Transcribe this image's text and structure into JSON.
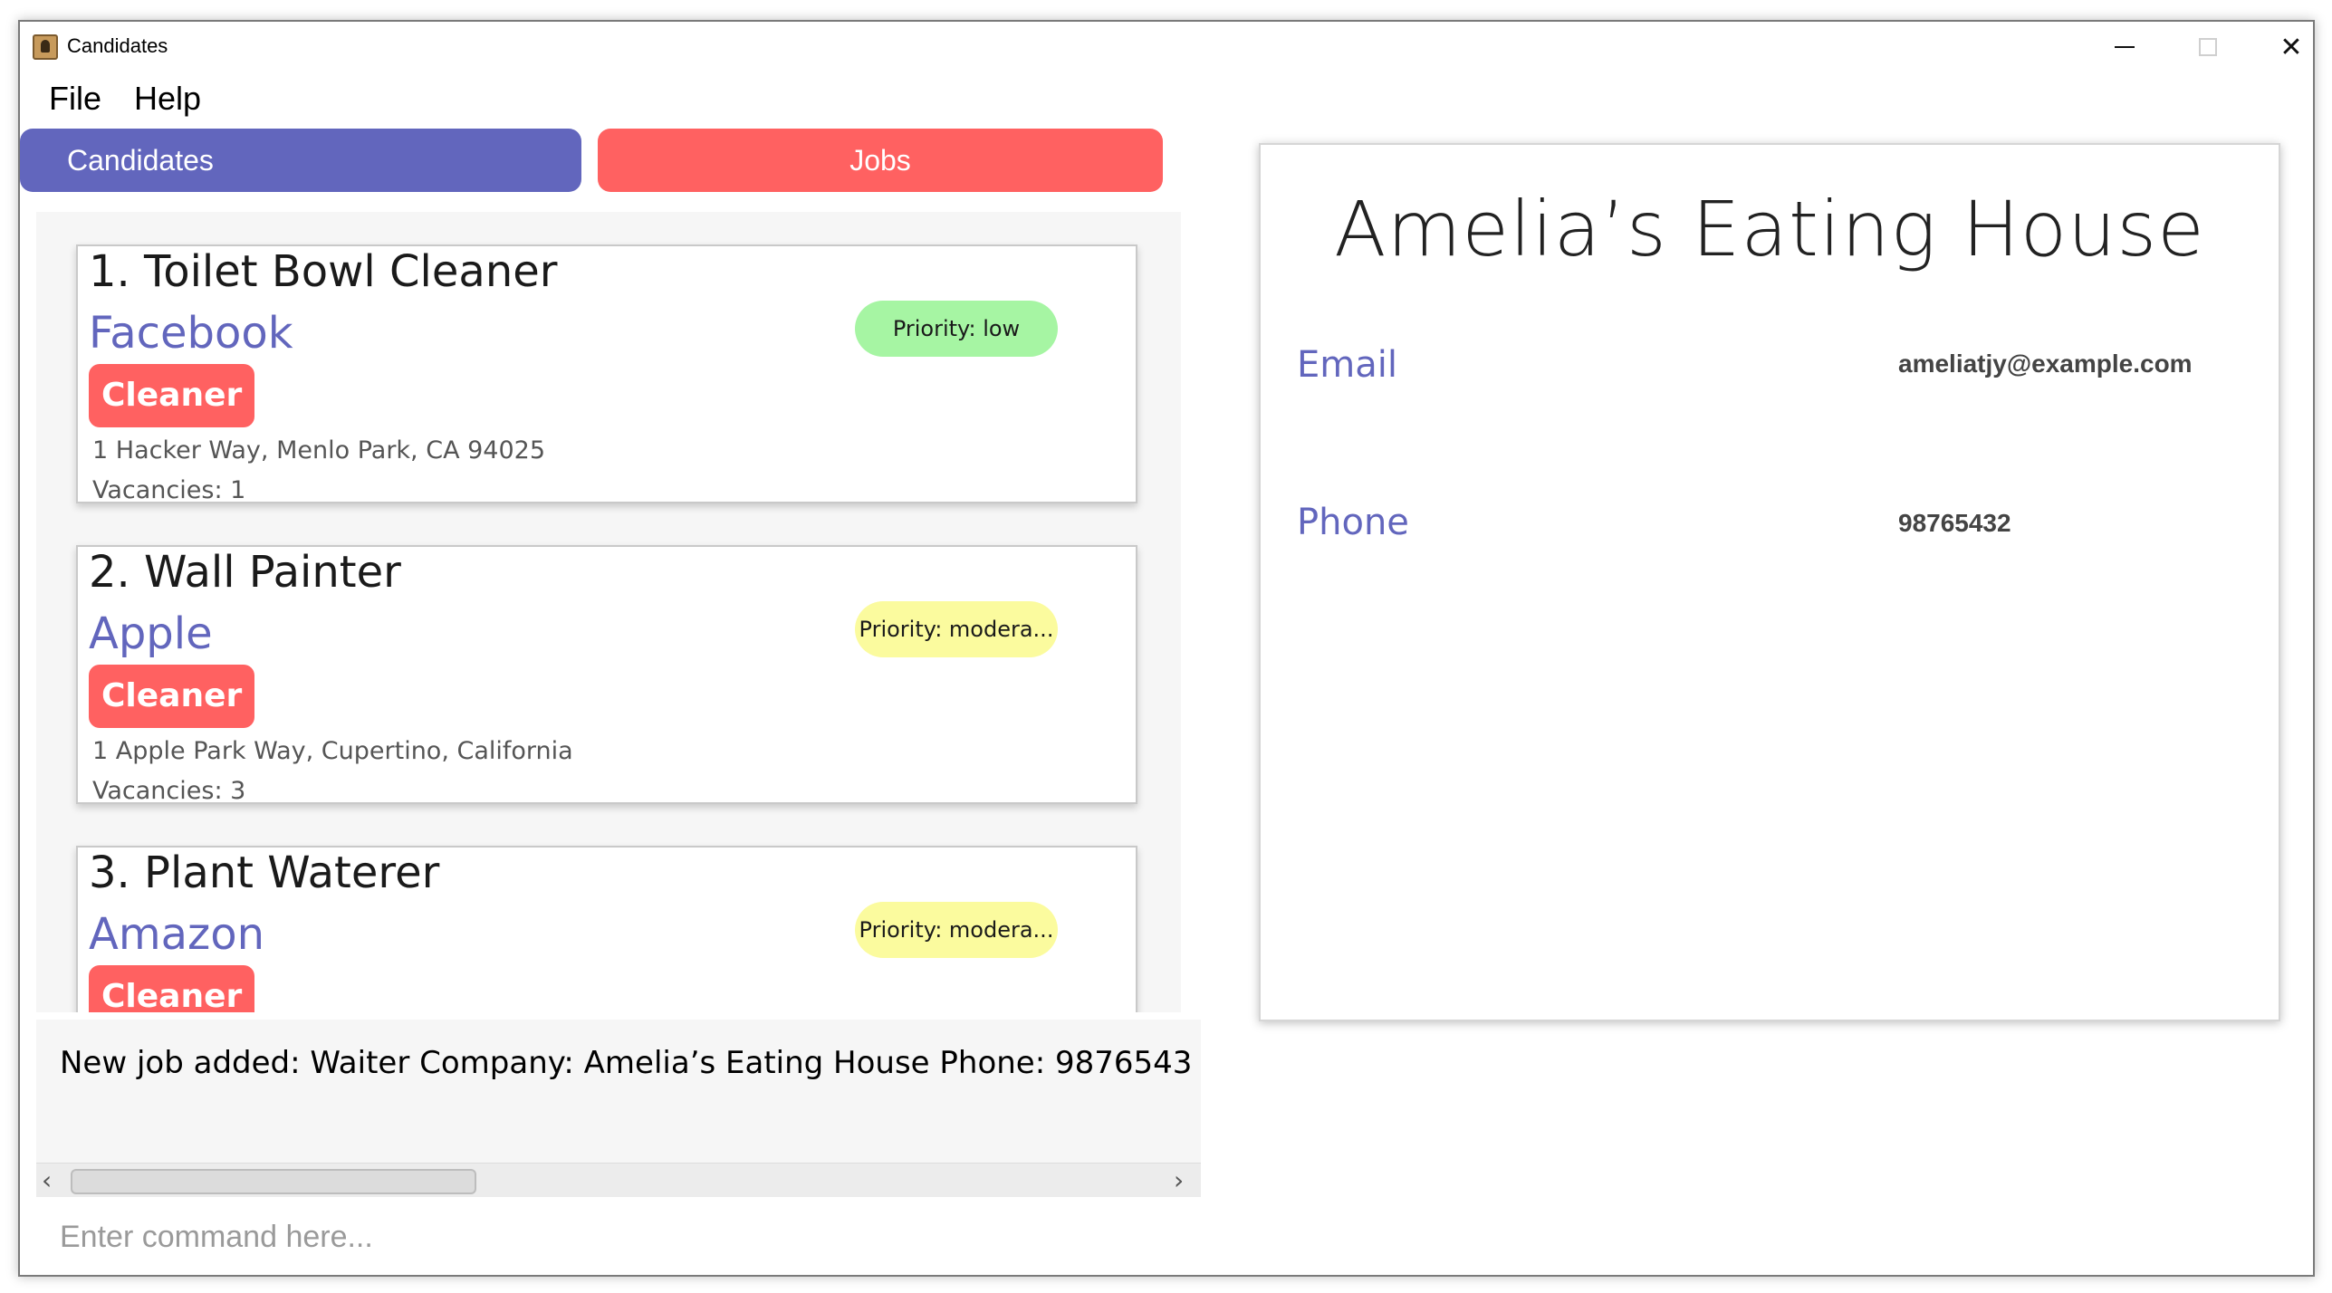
{
  "window": {
    "title": "Candidates",
    "controls": {
      "minimize": "minimize",
      "maximize": "maximize",
      "close": "close"
    }
  },
  "menu": {
    "file": "File",
    "help": "Help"
  },
  "tabs": {
    "candidates": "Candidates",
    "jobs": "Jobs"
  },
  "jobs": [
    {
      "index_title": "1.  Toilet Bowl Cleaner",
      "company": "Facebook",
      "tag": "Cleaner",
      "priority": "Priority: low",
      "address": "1 Hacker Way, Menlo Park, CA 94025",
      "vacancies": "Vacancies: 1"
    },
    {
      "index_title": "2.  Wall Painter",
      "company": "Apple",
      "tag": "Cleaner",
      "priority": "Priority: modera...",
      "address": "1 Apple Park Way, Cupertino, California",
      "vacancies": "Vacancies: 3"
    },
    {
      "index_title": "3.  Plant Waterer",
      "company": "Amazon",
      "tag": "Cleaner",
      "priority": "Priority: modera..."
    }
  ],
  "result": {
    "text": "New job added: Waiter Company: Amelia’s Eating House Phone: 9876543"
  },
  "command": {
    "placeholder": "Enter command here..."
  },
  "detail": {
    "title": "Amelia’s Eating House",
    "email_label": "Email",
    "email_value": "ameliatjy@example.com",
    "phone_label": "Phone",
    "phone_value": "98765432"
  },
  "colors": {
    "accent_blue": "#6266bd",
    "accent_red": "#ff6161",
    "priority_low": "#a6f5a3",
    "priority_moderate": "#fbfb9e"
  }
}
